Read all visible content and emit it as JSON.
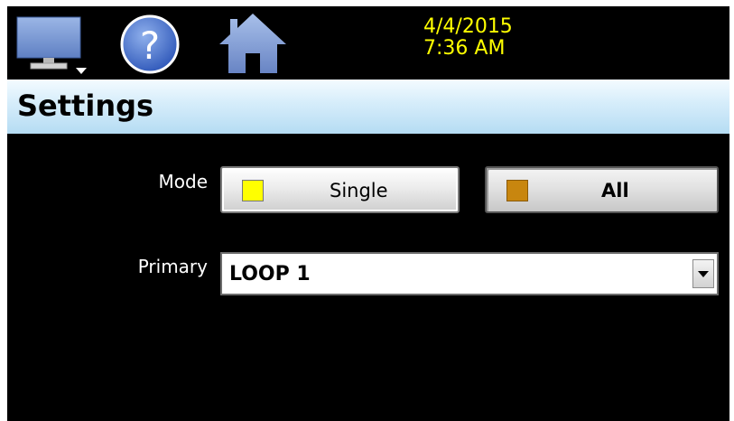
{
  "header": {
    "date": "4/4/2015",
    "time": "7:36 AM",
    "icons": [
      "monitor-icon",
      "help-icon",
      "home-icon"
    ]
  },
  "title": "Settings",
  "form": {
    "mode": {
      "label": "Mode",
      "options": [
        {
          "label": "Single",
          "indicator_color": "#ffff00"
        },
        {
          "label": "All",
          "indicator_color": "#c8860f"
        }
      ],
      "selected": "All"
    },
    "primary": {
      "label": "Primary",
      "value": "LOOP 1"
    }
  },
  "colors": {
    "background": "#000000",
    "datetime_text": "#ffff00",
    "titlebar": "#c9e6f8",
    "icon_blue": "#6f8fc8"
  }
}
